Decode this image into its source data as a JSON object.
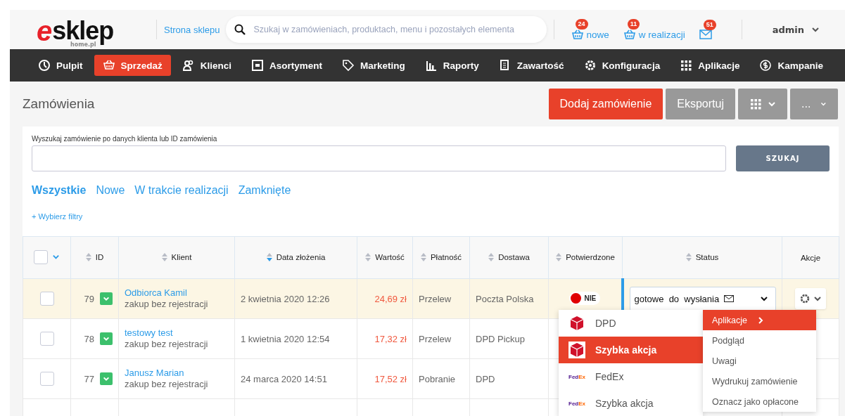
{
  "header": {
    "logo": {
      "mark": "e",
      "name": "sklep",
      "sub": "home.pl"
    },
    "shop_link": "Strona sklepu",
    "search": {
      "placeholder": "Szukaj w zamówieniach, produktach, menu i pozostałych elementa"
    },
    "counters": [
      {
        "kind": "basket",
        "count": "24",
        "label": "nowe"
      },
      {
        "kind": "basket",
        "count": "11",
        "label": "w realizacji"
      },
      {
        "kind": "mail",
        "count": "51"
      }
    ],
    "user": "admin"
  },
  "nav": [
    {
      "label": "Pulpit",
      "selected": false
    },
    {
      "label": "Sprzedaż",
      "selected": true
    },
    {
      "label": "Klienci",
      "selected": false
    },
    {
      "label": "Asortyment",
      "selected": false
    },
    {
      "label": "Marketing",
      "selected": false
    },
    {
      "label": "Raporty",
      "selected": false
    },
    {
      "label": "Zawartość",
      "selected": false
    },
    {
      "label": "Konfiguracja",
      "selected": false
    },
    {
      "label": "Aplikacje",
      "selected": false
    },
    {
      "label": "Kampanie",
      "selected": false
    }
  ],
  "page": {
    "title": "Zamówienia",
    "actions": [
      {
        "kind": "primary",
        "label": "Dodaj zamówienie"
      },
      {
        "kind": "secondary",
        "label": "Eksportuj"
      },
      {
        "kind": "grid"
      },
      {
        "kind": "more",
        "label": "..."
      }
    ]
  },
  "search": {
    "label": "Wyszukaj zamówienie po danych klienta lub ID zamówienia",
    "button": "SZUKAJ"
  },
  "filter_tabs": [
    {
      "label": "Wszystkie",
      "selected": true
    },
    {
      "label": "Nowe",
      "selected": false
    },
    {
      "label": "W trakcie realizacji",
      "selected": false
    },
    {
      "label": "Zamknięte",
      "selected": false
    }
  ],
  "add_filters": "+ Wybierz filtry",
  "table": {
    "all_checked": false,
    "columns": [
      {
        "kind": "select"
      },
      {
        "label": "ID",
        "sorted": false
      },
      {
        "label": "Klient",
        "sorted": false
      },
      {
        "label": "Data złożenia",
        "sorted": true
      },
      {
        "label": "Wartość",
        "sorted": false
      },
      {
        "label": "Płatność",
        "sorted": false
      },
      {
        "label": "Dostawa",
        "sorted": false
      },
      {
        "label": "Potwierdzone",
        "sorted": false
      },
      {
        "label": "Status",
        "sorted": false
      },
      {
        "label": "Akcje"
      }
    ],
    "rows": [
      {
        "selected": true,
        "checked": false,
        "id": "79",
        "client": "Odbiorca Kamil",
        "client_note": "zakup bez rejestracji",
        "date": "2 kwietnia 2020 12:26",
        "value": "24,69 zł",
        "payment": "Przelew",
        "delivery": "Poczta Polska",
        "confirmed": {
          "label": "NIE",
          "color": "#e00000"
        },
        "status": "gotowe  do  wysłania",
        "actions": true
      },
      {
        "selected": false,
        "checked": false,
        "id": "78",
        "client": "testowy test",
        "client_note": "zakup bez rejestracji",
        "date": "1 kwietnia 2020 12:54",
        "value": "17,32 zł",
        "payment": "Przelew",
        "delivery": "DPD Pickup"
      },
      {
        "selected": false,
        "checked": false,
        "id": "77",
        "client": "Janusz Marian",
        "client_note": "zakup bez rejestracji",
        "date": "24 marca 2020 14:51",
        "value": "17,52 zł",
        "payment": "Pobranie",
        "delivery": "DPD"
      }
    ]
  },
  "shipping_menu": [
    {
      "kind": "dpd",
      "label": "DPD",
      "selected": false
    },
    {
      "kind": "dpd",
      "label": "Szybka akcja",
      "selected": true
    },
    {
      "kind": "fedex",
      "logo": [
        "Fed",
        "Ex"
      ],
      "label": "FedEx",
      "selected": false
    },
    {
      "kind": "fedex",
      "logo": [
        "Fed",
        "Ex"
      ],
      "label": "Szybka akcja",
      "selected": false
    }
  ],
  "actions_menu": [
    {
      "label": "Aplikacje",
      "selected": true,
      "submenu": true
    },
    {
      "label": "Podgląd",
      "selected": false,
      "submenu": false
    },
    {
      "label": "Uwagi",
      "selected": false,
      "submenu": false
    },
    {
      "label": "Wydrukuj zamówienie",
      "selected": false,
      "submenu": false
    },
    {
      "label": "Oznacz jako opłacone",
      "selected": false,
      "submenu": false
    }
  ]
}
